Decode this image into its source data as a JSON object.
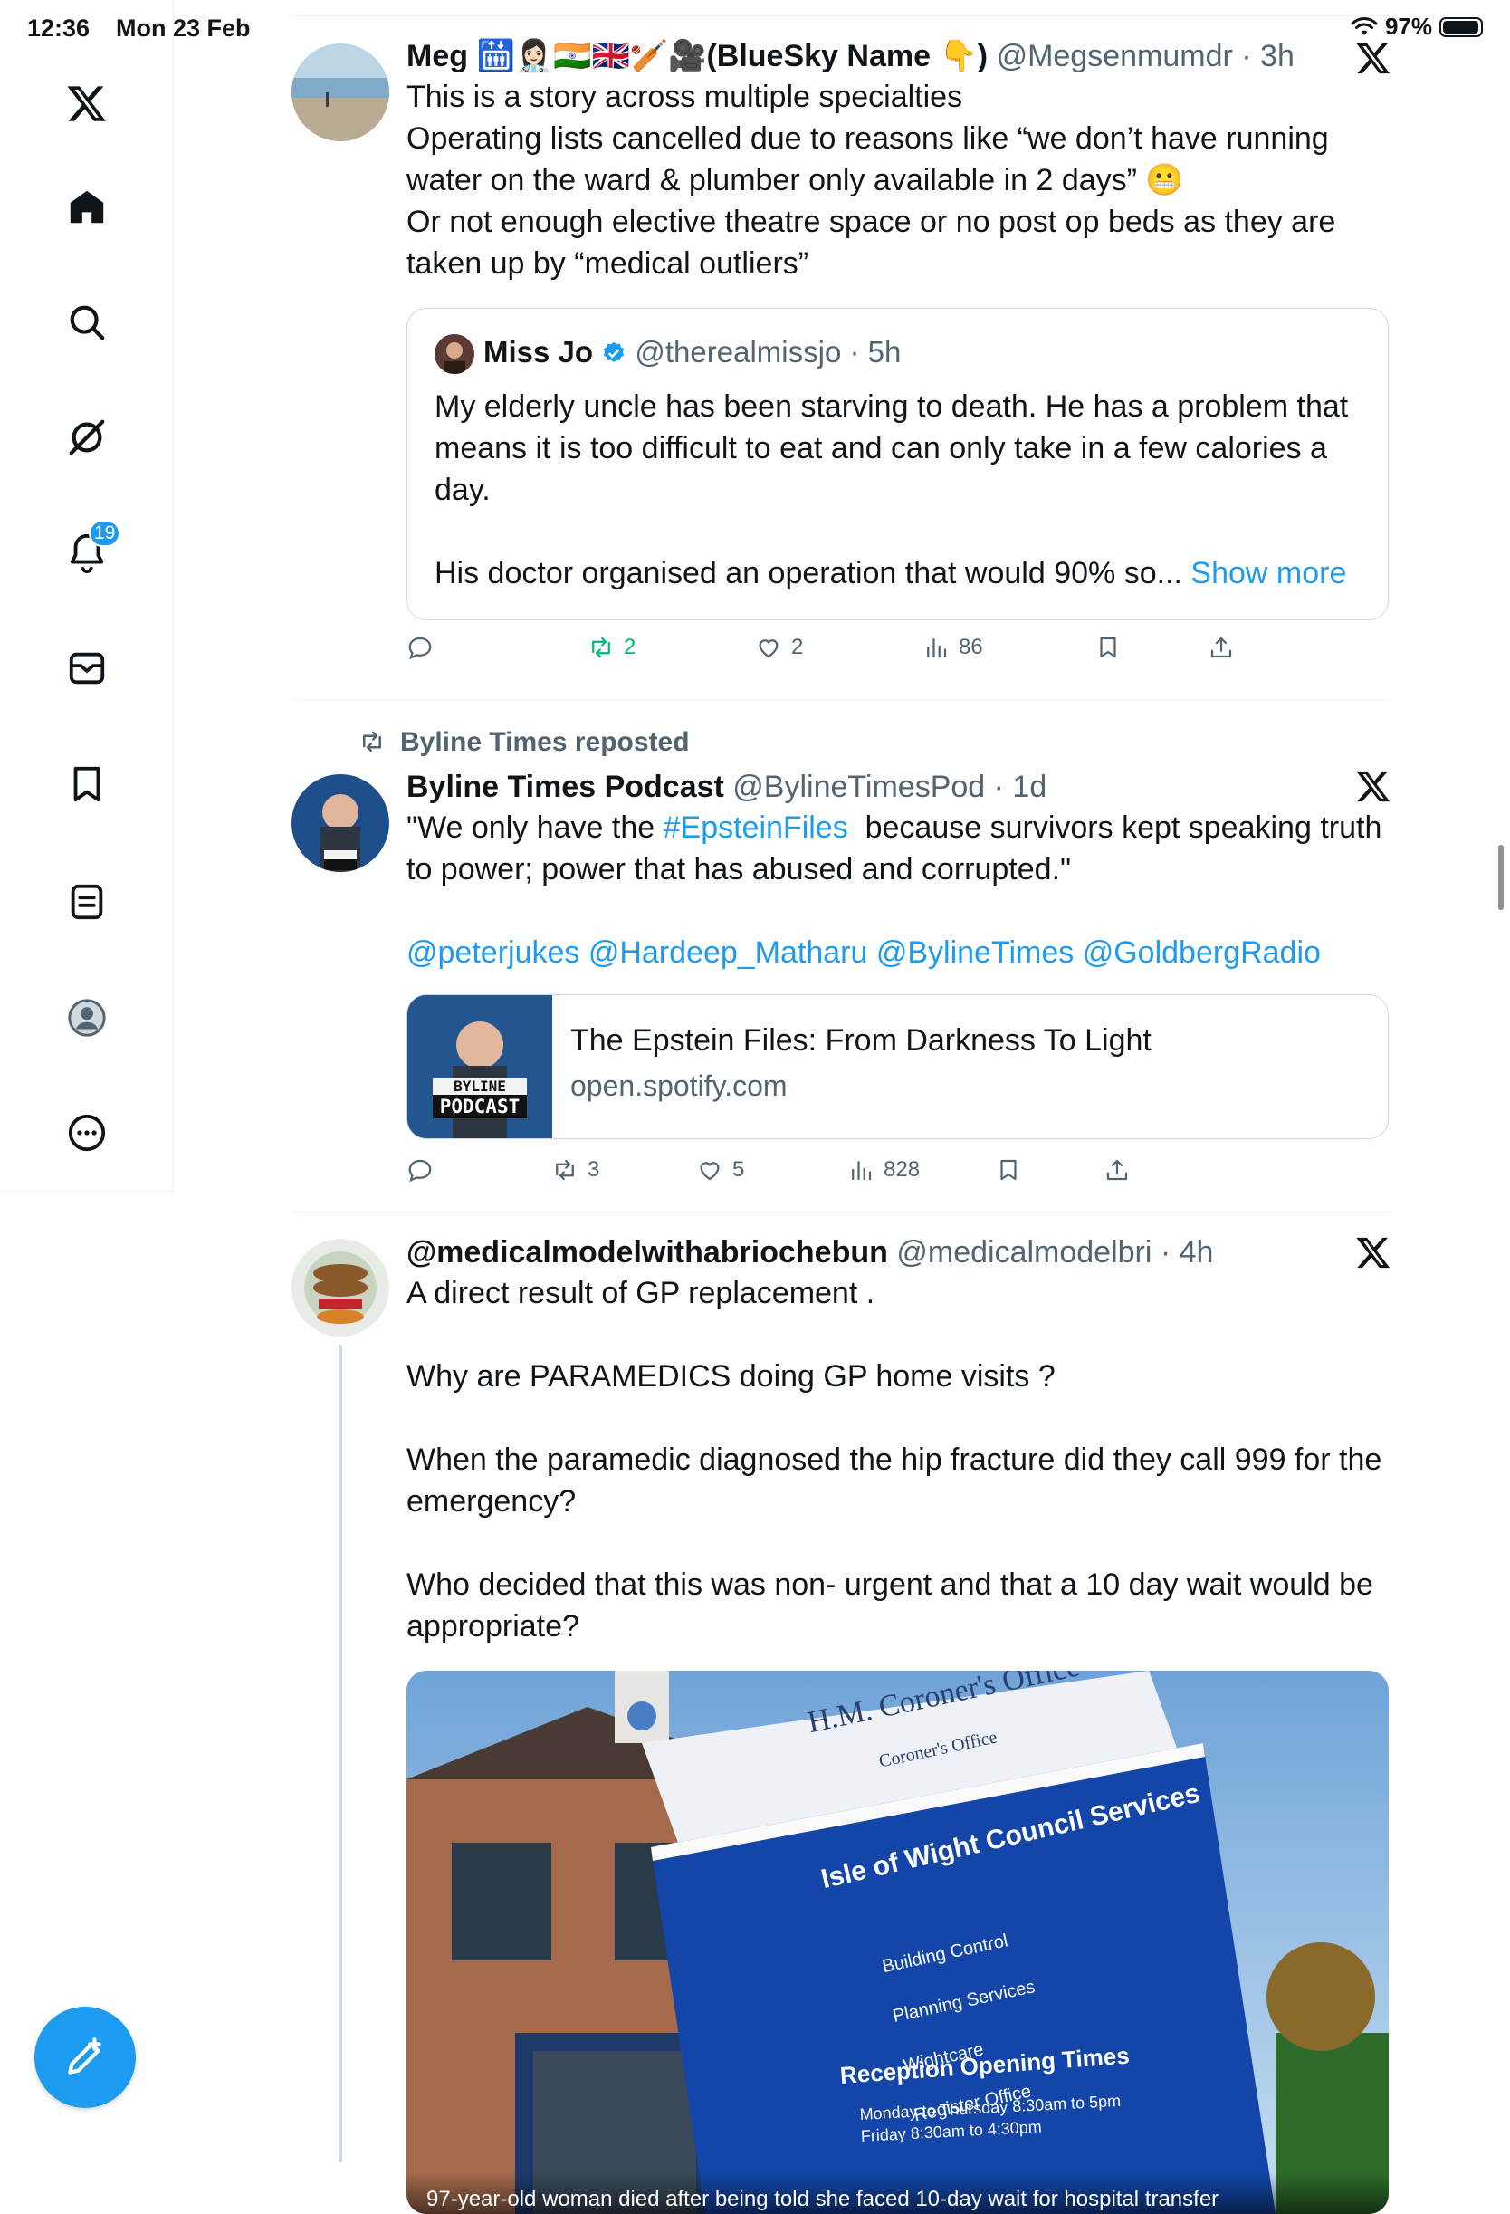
{
  "status": {
    "time": "12:36",
    "date": "Mon 23 Feb",
    "battery": "97%",
    "battery_level": 0.97
  },
  "sidebar": {
    "items": [
      {
        "label": "X logo",
        "icon": "x-logo-icon"
      },
      {
        "label": "Home",
        "icon": "home-icon"
      },
      {
        "label": "Search",
        "icon": "search-icon"
      },
      {
        "label": "Grok",
        "icon": "grok-icon"
      },
      {
        "label": "Notifications",
        "icon": "bell-icon"
      },
      {
        "label": "Messages",
        "icon": "mail-icon"
      },
      {
        "label": "Bookmarks",
        "icon": "bookmark-icon"
      },
      {
        "label": "Lists",
        "icon": "list-icon"
      },
      {
        "label": "Profile",
        "icon": "profile-icon"
      },
      {
        "label": "More",
        "icon": "more-icon"
      }
    ],
    "notification_count": "19"
  },
  "posts": [
    {
      "name": "Meg 🛗👩🏻‍⚕️🇮🇳🇬🇧🏏🎥(BlueSky Name 👇)",
      "handle": "@Megsenmumdr",
      "time": "3h",
      "text": "This is a story across multiple specialties\nOperating lists cancelled due to reasons like “we don’t have running water on the ward & plumber only available in 2 days” 😬\nOr not enough elective theatre space or no post op beds as they are taken up by “medical outliers”",
      "quote": {
        "name": "Miss Jo",
        "handle": "@therealmissjo",
        "time": "5h",
        "text": "My elderly uncle has been starving to death. He has a problem that means it is too difficult to eat and can only take in a few calories a day.\n\nHis doctor organised an operation that would 90% so...",
        "show_more": "Show more"
      },
      "actions": {
        "replies": "",
        "reposts": "2",
        "likes": "2",
        "views": "86"
      }
    },
    {
      "repost_label": "Byline Times reposted",
      "name": "Byline Times Podcast",
      "handle": "@BylineTimesPod",
      "time": "1d",
      "text_before": "\"We only have the ",
      "hashtag": "#EpsteinFiles",
      "text_after": "  because survivors kept speaking truth to power; power that has abused and corrupted.\"",
      "mentions": "@peterjukes @Hardeep_Matharu @BylineTimes @GoldbergRadio",
      "card": {
        "title": "The Epstein Files: From Darkness To Light",
        "domain": "open.spotify.com",
        "thumb_line1": "BYLINE",
        "thumb_line2": "PODCAST"
      },
      "actions": {
        "replies": "",
        "reposts": "3",
        "likes": "5",
        "views": "828"
      }
    },
    {
      "name": "@medicalmodelwithabriochebun",
      "handle": "@medicalmodelbri",
      "time": "4h",
      "text": "A direct result of GP replacement .\n\nWhy are PARAMEDICS doing GP home visits ?\n\nWhen the paramedic diagnosed the hip fracture did they call 999 for the emergency?\n\nWho decided that this was non- urgent and that a 10 day wait would be appropriate?",
      "media": {
        "sign_top": "H.M. Coroner's Office",
        "sign_sub": "Coroner's Office",
        "council": "Isle of Wight Council Services",
        "services": [
          "Building Control",
          "Planning Services",
          "Wightcare",
          "Register Office"
        ],
        "opening": "Reception Opening Times",
        "hours1": "Monday to Thursday 8:30am to 5pm",
        "hours2": "Friday 8:30am to 4:30pm",
        "caption": "97-year-old woman died after being told she faced 10-day wait for hospital transfer"
      }
    }
  ]
}
